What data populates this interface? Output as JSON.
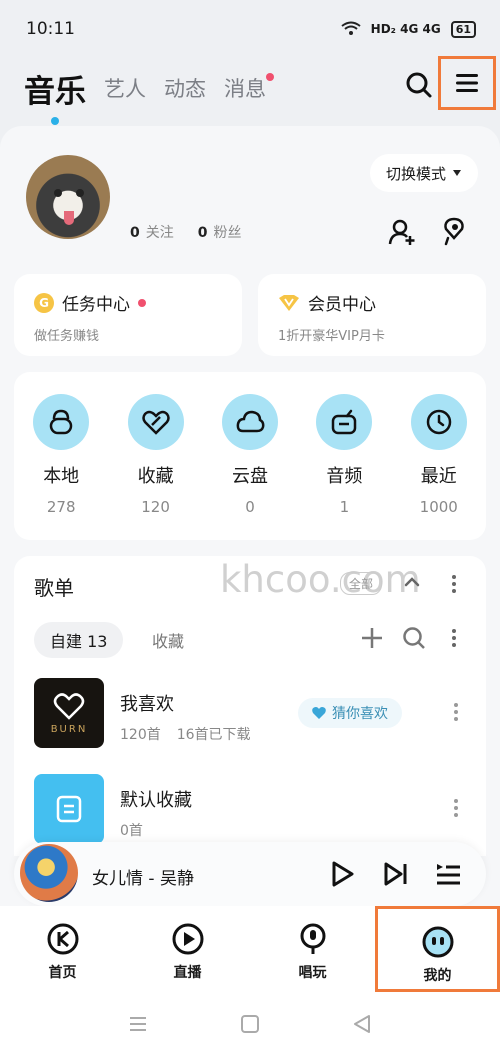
{
  "status_bar": {
    "time": "10:11",
    "network": "HD₂ 4G 4G",
    "battery": "61"
  },
  "top_nav": {
    "tabs": [
      {
        "label": "音乐",
        "active": true
      },
      {
        "label": "艺人",
        "active": false
      },
      {
        "label": "动态",
        "active": false
      },
      {
        "label": "消息",
        "active": false,
        "badge": true
      }
    ]
  },
  "profile": {
    "following_count": "0",
    "following_label": "关注",
    "fans_count": "0",
    "fans_label": "粉丝",
    "mode_button": "切换模式"
  },
  "promos": [
    {
      "title": "任务中心",
      "subtitle": "做任务赚钱",
      "icon": "coin-icon"
    },
    {
      "title": "会员中心",
      "subtitle": "1折开豪华VIP月卡",
      "icon": "vip-diamond-icon"
    }
  ],
  "shortcuts": [
    {
      "label": "本地",
      "count": "278",
      "icon": "local-music-icon"
    },
    {
      "label": "收藏",
      "count": "120",
      "icon": "favorite-icon"
    },
    {
      "label": "云盘",
      "count": "0",
      "icon": "cloud-icon"
    },
    {
      "label": "音频",
      "count": "1",
      "icon": "radio-icon"
    },
    {
      "label": "最近",
      "count": "1000",
      "icon": "clock-icon"
    }
  ],
  "playlists": {
    "header": "歌单",
    "filter": "全部",
    "watermark": "khcoo.com",
    "tab_created": "自建 13",
    "tab_collected": "收藏",
    "items": [
      {
        "name": "我喜欢",
        "count": "120首",
        "downloaded": "16首已下载",
        "badge": "猜你喜欢",
        "cover_text": "BURN"
      },
      {
        "name": "默认收藏",
        "count": "0首"
      }
    ]
  },
  "player": {
    "title": "女儿情 - 吴静"
  },
  "bottom_nav": [
    {
      "label": "首页",
      "icon": "home-k-icon"
    },
    {
      "label": "直播",
      "icon": "live-icon"
    },
    {
      "label": "唱玩",
      "icon": "sing-icon"
    },
    {
      "label": "我的",
      "icon": "profile-face-icon",
      "active": true
    }
  ],
  "colors": {
    "accent": "#2ab0e8",
    "highlight_box": "#f07a3a",
    "shortcut_bg": "#a8e2f5"
  }
}
